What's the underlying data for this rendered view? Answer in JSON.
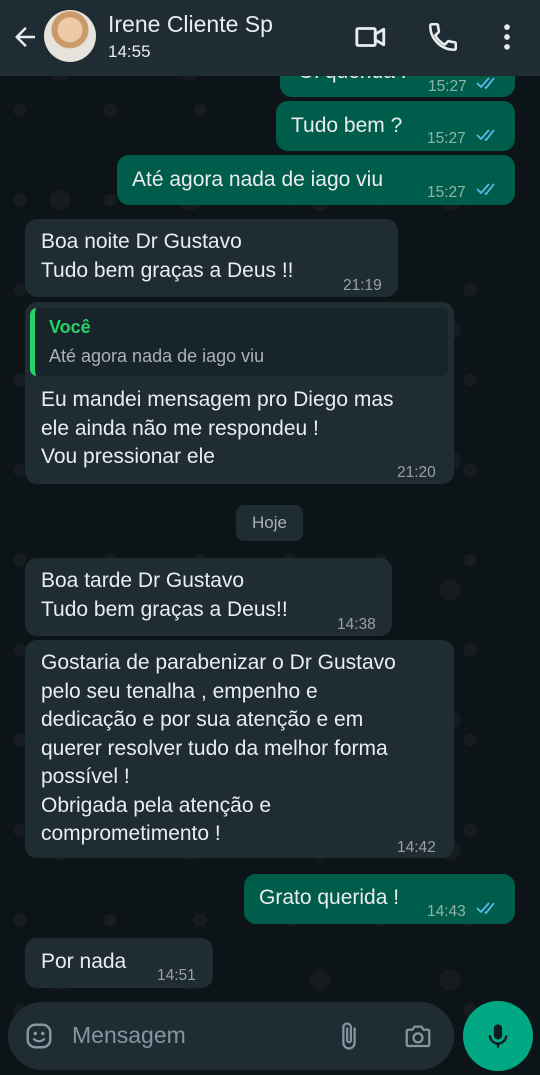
{
  "header": {
    "contact_name": "Irene Cliente Sp",
    "status": "14:55",
    "icons": [
      "back-arrow-icon",
      "video-call-icon",
      "phone-icon",
      "more-vertical-icon"
    ]
  },
  "messages": [
    {
      "dir": "out",
      "text": "Oi querida !",
      "time": "15:27",
      "read": true
    },
    {
      "dir": "out",
      "text": "Tudo bem ?",
      "time": "15:27",
      "read": true
    },
    {
      "dir": "out",
      "text": "Até agora nada de iago viu",
      "time": "15:27",
      "read": true
    },
    {
      "dir": "in",
      "text": "Boa noite Dr Gustavo\nTudo bem graças a Deus !!",
      "time": "21:19"
    },
    {
      "dir": "in",
      "reply": {
        "author": "Você",
        "text": "Até agora nada de iago viu"
      },
      "text": "Eu mandei mensagem pro Diego mas\nele ainda não me respondeu !\nVou pressionar ele",
      "time": "21:20"
    },
    {
      "dir": "in",
      "text": "Boa tarde Dr Gustavo\nTudo bem graças a Deus!!",
      "time": "14:38"
    },
    {
      "dir": "in",
      "text": "Gostaria de parabenizar o Dr Gustavo\npelo seu tenalha , empenho e\ndedicação e por sua atenção e  em\nquerer resolver tudo da melhor forma\npossível !\nObrigada pela atenção e\ncomprometimento !",
      "time": "14:42"
    },
    {
      "dir": "out",
      "text": "Grato querida !",
      "time": "14:43",
      "read": true
    },
    {
      "dir": "in",
      "text": "Por nada",
      "time": "14:51"
    }
  ],
  "date_separator": "Hoje",
  "input": {
    "placeholder": "Mensagem"
  },
  "colors": {
    "header": "#1f2c33",
    "incoming": "#1f2c33",
    "outgoing": "#005c4b",
    "accent": "#00a884",
    "tick_read": "#53bdeb"
  }
}
